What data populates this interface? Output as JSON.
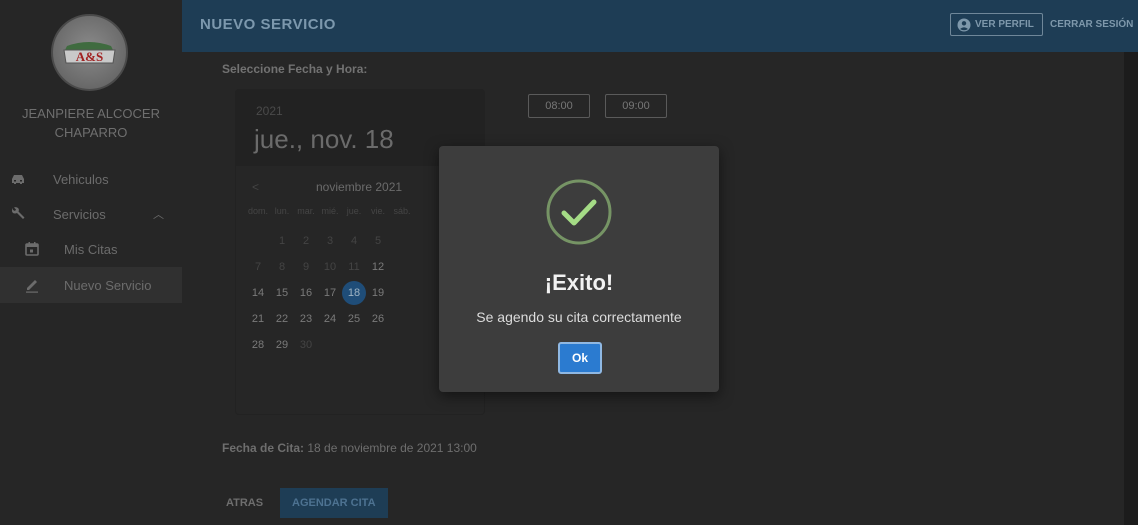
{
  "sidebar": {
    "logo_text": "A&S",
    "user_name_line1": "JEANPIERE ALCOCER",
    "user_name_line2": "CHAPARRO",
    "items": [
      {
        "label": "Vehiculos",
        "icon": "car-icon"
      },
      {
        "label": "Servicios",
        "icon": "wrench-icon",
        "expanded": true
      },
      {
        "label": "Mis Citas",
        "icon": "calendar-icon"
      },
      {
        "label": "Nuevo Servicio",
        "icon": "pencil-icon",
        "active": true
      }
    ]
  },
  "header": {
    "title": "NUEVO SERVICIO",
    "profile_label": "VER PERFIL",
    "logout_label": "CERRAR SESIÓN"
  },
  "main": {
    "section_label": "Seleccione Fecha y Hora:",
    "picker": {
      "year": "2021",
      "date_display": "jue., nov. 18",
      "month_label": "noviembre 2021",
      "prev_icon": "chevron-left-icon",
      "weekdays": [
        "dom.",
        "lun.",
        "mar.",
        "mié.",
        "jue.",
        "vie.",
        "sáb."
      ],
      "selected_day": "18"
    },
    "time_slots": [
      "08:00",
      "09:00"
    ],
    "fecha_label": "Fecha de Cita:",
    "fecha_value": "18 de noviembre de 2021 13:00",
    "back_label": "ATRAS",
    "submit_label": "AGENDAR CITA"
  },
  "modal": {
    "icon": "success-check-icon",
    "title": "¡Exito!",
    "message": "Se agendo su cita correctamente",
    "ok_label": "Ok",
    "accent_color": "#a5dc86",
    "button_color": "#2b7bd0"
  }
}
